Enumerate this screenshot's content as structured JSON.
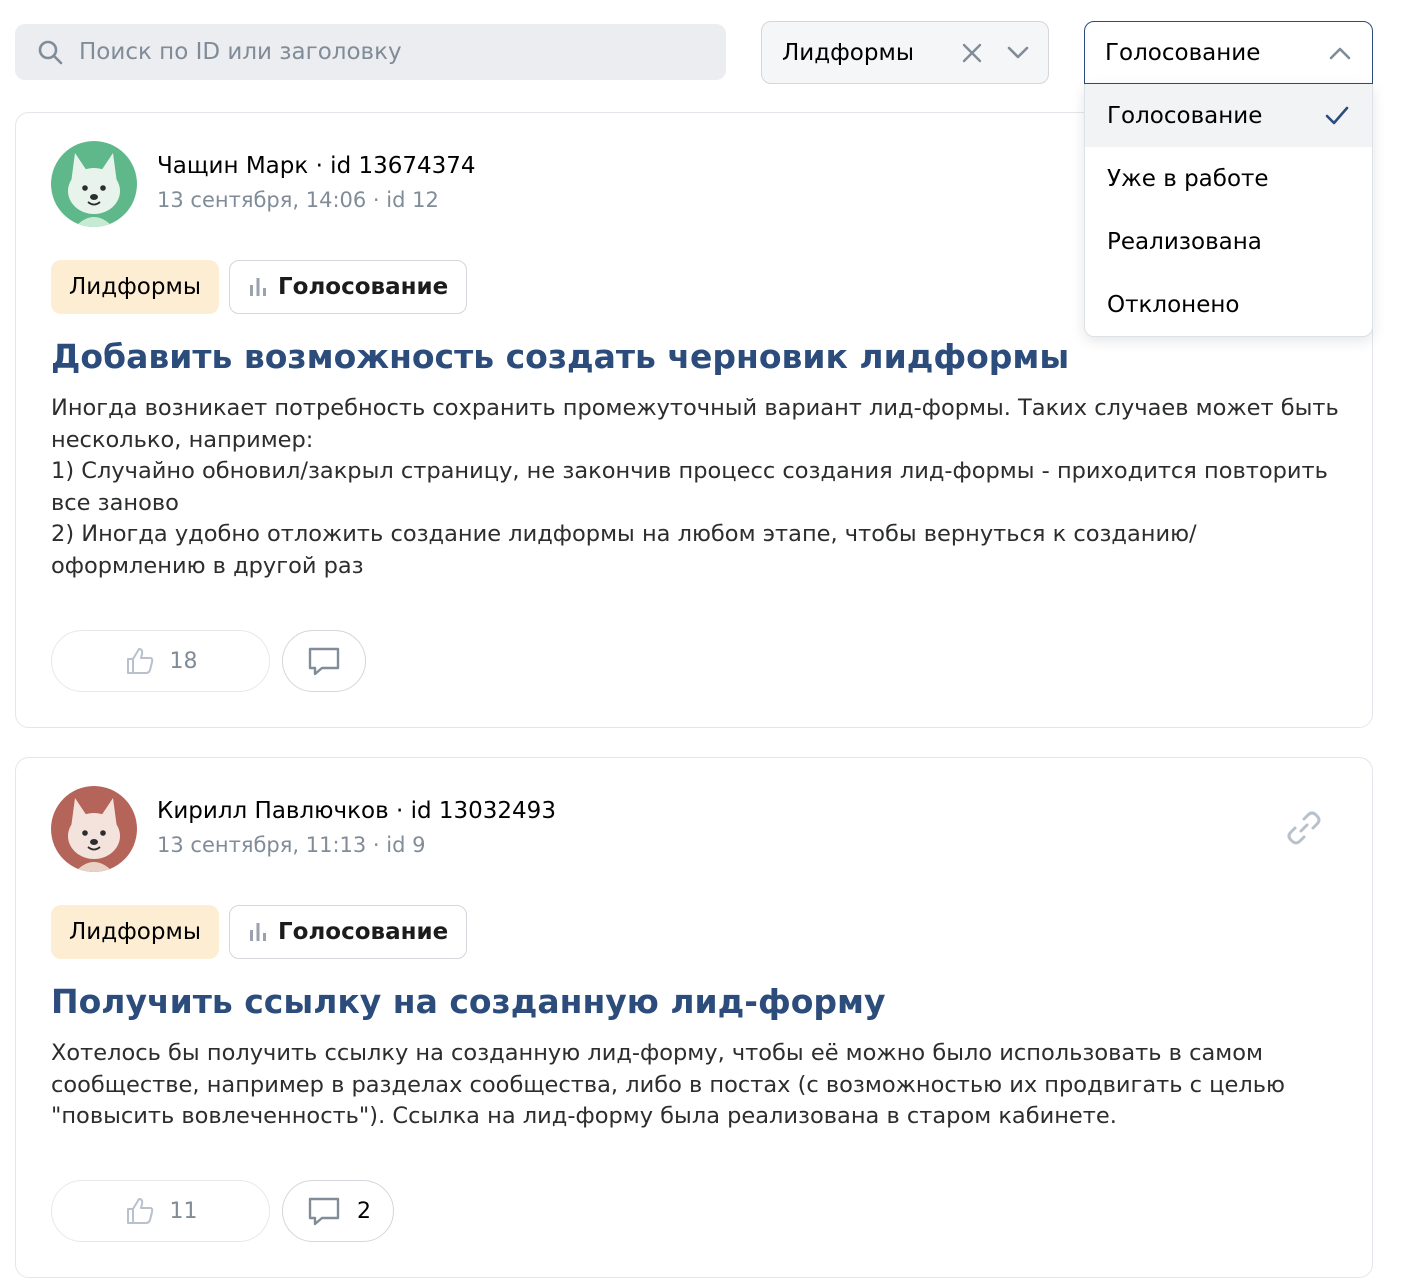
{
  "search": {
    "placeholder": "Поиск по ID или заголовку"
  },
  "filters": {
    "category": {
      "value": "Лидформы"
    },
    "status": {
      "value": "Голосование",
      "options": [
        "Голосование",
        "Уже в работе",
        "Реализована",
        "Отклонено"
      ],
      "selected_index": 0
    }
  },
  "posts": [
    {
      "author": "Чащин Марк · id 13674374",
      "meta": "13 сентября, 14:06 · id 12",
      "avatar_color": "#5fb889",
      "category_tag": "Лидформы",
      "status_tag": "Голосование",
      "title": "Добавить возможность создать черновик лидформы",
      "description": "Иногда возникает потребность сохранить промежуточный вариант лид-формы. Таких случаев может быть несколько, например:\n1) Случайно обновил/закрыл страницу, не закончив процесс создания лид-формы - приходится повторить все заново\n2) Иногда удобно отложить создание лидформы на любом этапе, чтобы вернуться к созданию/оформлению в другой раз",
      "likes": "18",
      "comments": ""
    },
    {
      "author": "Кирилл Павлючков · id 13032493",
      "meta": "13 сентября, 11:13 · id 9",
      "avatar_color": "#b5645a",
      "category_tag": "Лидформы",
      "status_tag": "Голосование",
      "title": "Получить ссылку на созданную лид-форму",
      "description": "Хотелось бы получить ссылку на созданную лид-форму, чтобы её можно было использовать в самом сообществе, например в разделах сообщества, либо в постах (с возможностью их продвигать с целью \"повысить вовлеченность\"). Ссылка на лид-форму была реализована в старом кабинете.",
      "likes": "11",
      "comments": "2"
    }
  ],
  "colors": {
    "accent": "#2c4c7c",
    "muted": "#818c99",
    "category_tag_bg": "#fdeed3"
  },
  "icons": [
    "search-icon",
    "clear-icon",
    "chevron-down-icon",
    "chevron-up-icon",
    "check-icon",
    "link-icon",
    "bars-icon",
    "thumbs-up-icon",
    "comment-icon"
  ]
}
